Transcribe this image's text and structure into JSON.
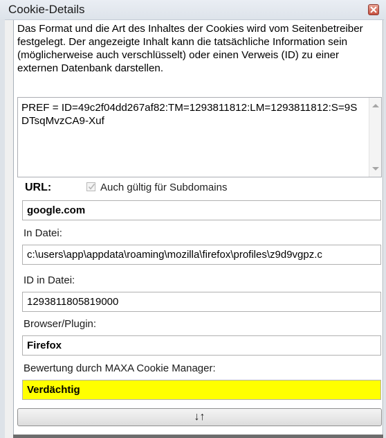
{
  "window": {
    "title": "Cookie-Details"
  },
  "description": "Das Format und die Art des Inhaltes der Cookies wird vom Seitenbetreiber festgelegt. Der angezeigte Inhalt kann die tatsächliche Information sein (möglicherweise auch verschlüsselt) oder einen Verweis (ID) zu einer externen Datenbank darstellen.",
  "cookie_content": "PREF = ID=49c2f04dd267af82:TM=1293811812:LM=1293811812:S=9SDTsqMvzCA9-Xuf",
  "url": {
    "label": "URL:",
    "subdomain_checkbox_label": "Auch gültig für Subdomains",
    "subdomain_checked": true,
    "value": "google.com"
  },
  "file": {
    "label": "In Datei:",
    "value": "c:\\users\\app\\appdata\\roaming\\mozilla\\firefox\\profiles\\z9d9vgpz.c"
  },
  "file_id": {
    "label": "ID in Datei:",
    "value": "1293811805819000"
  },
  "browser": {
    "label": "Browser/Plugin:",
    "value": "Firefox"
  },
  "rating": {
    "label": "Bewertung durch MAXA Cookie Manager:",
    "value": "Verdächtig",
    "color": "#ffff00"
  },
  "toggle_button": {
    "label": "↓↑"
  }
}
